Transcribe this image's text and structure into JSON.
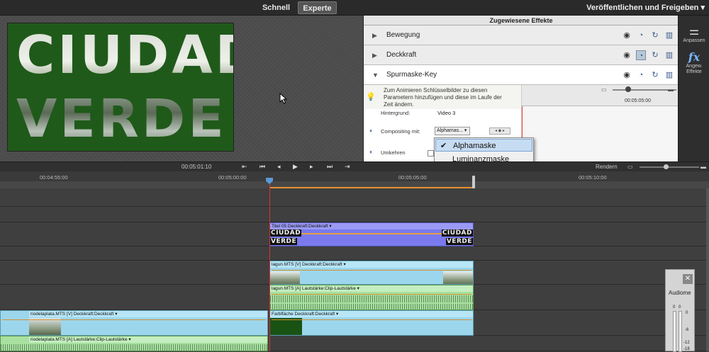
{
  "topbar": {
    "mode_quick": "Schnell",
    "mode_expert": "Experte",
    "publish": "Veröffentlichen und Freigeben"
  },
  "preview": {
    "line1": "CIUDAD",
    "line2": "VERDE"
  },
  "effects": {
    "title": "Zugewiesene Effekte",
    "items": [
      {
        "label": "Bewegung",
        "expanded": false
      },
      {
        "label": "Deckkraft",
        "expanded": false
      },
      {
        "label": "Spurmaske-Key",
        "expanded": true
      }
    ],
    "hint": "Zum Animieren Schlüsselbilder zu diesen Parametern hinzufügen und diese im Laufe der Zeit ändern.",
    "background_label": "Hintergrund:",
    "background_value": "Video 3",
    "compositing_label": "Compositing mit:",
    "compositing_value": "Alphamas...",
    "invert_label": "Umkehren",
    "keyframe_time": "00:05:05:00"
  },
  "dropdown": {
    "options": [
      {
        "label": "Alphamaske",
        "selected": true
      },
      {
        "label": "Luminanzmaske",
        "selected": false
      }
    ]
  },
  "rightpanel": {
    "adjust": "Anpassen",
    "applied": "Angew. Effekte"
  },
  "transport": {
    "timecode": "00:05:01:10",
    "render": "Rendern"
  },
  "ruler": {
    "t1": "00:04:55:00",
    "t2": "00:05:00:00",
    "t3": "00:05:05:00",
    "t4": "00:05:10:00"
  },
  "tracks": {
    "title_clip": "Titel 05   Deckkraft:Deckkraft ▾",
    "title_word1": "CIUDAD",
    "title_word2": "VERDE",
    "lagun_v": "lagun.MTS [V]   Deckkraft:Deckkraft ▾",
    "lagun_a": "lagun.MTS [A]   Lautstärke:Clip-Lautstärke ▾",
    "rio_v": "riodelaplata.MTS [V]   Deckkraft:Deckkraft ▾",
    "farbflaeche": "Farbfläche   Deckkraft:Deckkraft ▾",
    "rio_a": "riodelaplata.MTS [A]   Lautstärke:Clip-Lautstärke ▾"
  },
  "audiometer": {
    "label": "Audiome",
    "ticks": [
      "0",
      "-6",
      "-12",
      "-18"
    ],
    "bar_ticks": [
      "0",
      "0"
    ]
  },
  "colors": {
    "title_clip": "#7a7aee",
    "video_clip": "#9cd6ec",
    "audio_clip": "#a8e0a0",
    "playhead": "#e03030",
    "orange": "#e8922a"
  }
}
